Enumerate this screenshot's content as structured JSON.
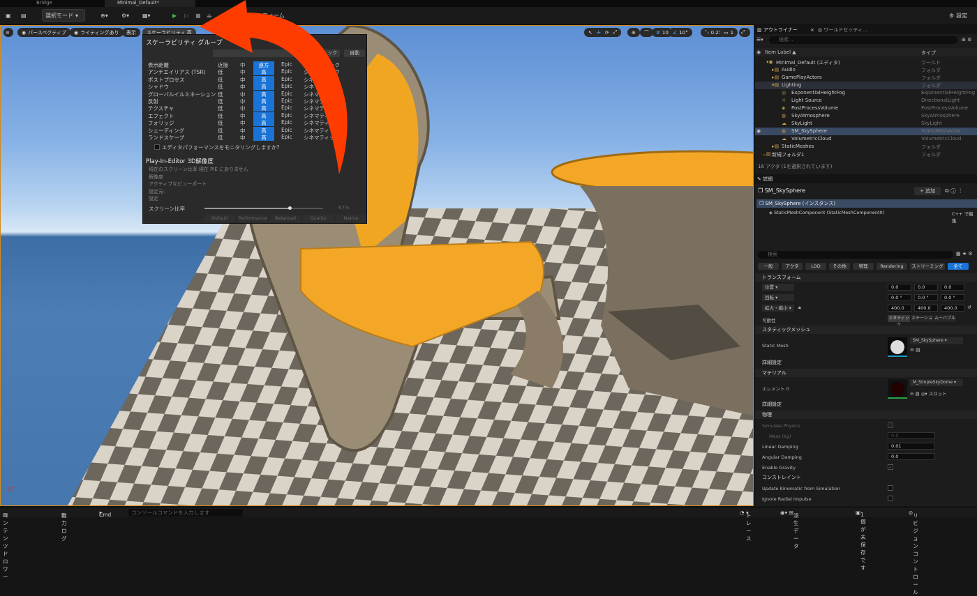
{
  "tabs": {
    "bridge": "Bridge",
    "level": "Minimal_Default*"
  },
  "toolbar": {
    "select_mode": "選択モード",
    "platform": "プラットフォーム",
    "settings": "設定"
  },
  "viewport": {
    "btn_perspective": "パースペクティブ",
    "btn_lighting": "ライティングあり",
    "btn_show": "表示",
    "btn_scalability": "スケーラビリティ 高",
    "grid_snap": "10",
    "rot_snap": "10°",
    "scale_snap": "0.25",
    "cam_speed": "1"
  },
  "scalability": {
    "title": "スケーラビリティ グループ",
    "auto": "自動",
    "cinematic_hdr": "シネマティック",
    "rows": [
      {
        "label": "表示距離",
        "c1": "近接",
        "c2": "中",
        "c3": "遠方",
        "c4": "Epic",
        "c5": "シネマティック"
      },
      {
        "label": "アンチエイリアス (TSR)",
        "c1": "低",
        "c2": "中",
        "c3": "高",
        "c4": "Epic",
        "c5": "シネマティック"
      },
      {
        "label": "ポストプロセス",
        "c1": "低",
        "c2": "中",
        "c3": "高",
        "c4": "Epic",
        "c5": "シネマティック"
      },
      {
        "label": "シャドウ",
        "c1": "低",
        "c2": "中",
        "c3": "高",
        "c4": "Epic",
        "c5": "シネマティック"
      },
      {
        "label": "グローバルイルミネーション",
        "c1": "低",
        "c2": "中",
        "c3": "高",
        "c4": "Epic",
        "c5": "シネマティック"
      },
      {
        "label": "反射",
        "c1": "低",
        "c2": "中",
        "c3": "高",
        "c4": "Epic",
        "c5": "シネマティック"
      },
      {
        "label": "テクスチャ",
        "c1": "低",
        "c2": "中",
        "c3": "高",
        "c4": "Epic",
        "c5": "シネマティック"
      },
      {
        "label": "エフェクト",
        "c1": "低",
        "c2": "中",
        "c3": "高",
        "c4": "Epic",
        "c5": "シネマティック"
      },
      {
        "label": "フォリッジ",
        "c1": "低",
        "c2": "中",
        "c3": "高",
        "c4": "Epic",
        "c5": "シネマティック"
      },
      {
        "label": "シェーディング",
        "c1": "低",
        "c2": "中",
        "c3": "高",
        "c4": "Epic",
        "c5": "シネマティック"
      },
      {
        "label": "ランドスケープ",
        "c1": "低",
        "c2": "中",
        "c3": "高",
        "c4": "Epic",
        "c5": "シネマティック"
      }
    ],
    "monitor": "エディタパフォーマンスをモニタリングしますか?",
    "pie_title": "Play-In-Editor 3D解像度",
    "pie_lines": [
      "現在のスクリーン比率 現在 PIE にありません",
      "解像度",
      "アクティブなビューポート",
      "設定元:",
      "設定"
    ],
    "screen_ratio": "スクリーン比率",
    "screen_pct": "67%",
    "screen_fill": 0.72,
    "presets": [
      "Default",
      "Performance",
      "Balanced",
      "Quality",
      "Native"
    ]
  },
  "outliner": {
    "tab": "アウトライナー",
    "tab2": "ワールドセッティ...",
    "search": "検索...",
    "col_label": "Item Label ▲",
    "col_type": "タイプ",
    "items": [
      {
        "label": "Minimal_Default (エディタ)",
        "type": "ワールド"
      },
      {
        "label": "Audio",
        "type": "フォルダ"
      },
      {
        "label": "GamePlayActors",
        "type": "フォルダ"
      },
      {
        "label": "Lighting",
        "type": "フォルダ"
      },
      {
        "label": "ExponentialHeightFog",
        "type": "ExponentialHeightFog"
      },
      {
        "label": "Light Source",
        "type": "DirectionalLight"
      },
      {
        "label": "PostProcessVolume",
        "type": "PostProcessVolume"
      },
      {
        "label": "SkyAtmosphere",
        "type": "SkyAtmosphere"
      },
      {
        "label": "SkyLight",
        "type": "SkyLight"
      },
      {
        "label": "SM_SkySphere",
        "type": "StaticMeshActor"
      },
      {
        "label": "VolumetricCloud",
        "type": "VolumetricCloud"
      },
      {
        "label": "StaticMeshes",
        "type": "フォルダ"
      },
      {
        "label": "新規フォルダ1",
        "type": "フォルダ"
      }
    ],
    "count": "16 アクタ (1を選択されています)"
  },
  "details": {
    "tab": "詳細",
    "name": "SM_SkySphere",
    "add": "+ 追加",
    "instance": "SM_SkySphere (インスタンス)",
    "component": "StaticMeshComponent (StaticMeshComponent0)",
    "cpp": "C++ で編集",
    "search": "検索",
    "filters": [
      "一般",
      "アクタ",
      "LOD",
      "その他",
      "物理",
      "Rendering",
      "ストリーミング",
      "全て"
    ],
    "transform": "トランスフォーム",
    "loc": "位置",
    "rot": "回転",
    "scale": "拡大・縮小",
    "loc_vals": [
      "0.0",
      "0.0",
      "0.0"
    ],
    "rot_vals": [
      "0.0 °",
      "0.0 °",
      "0.0 °"
    ],
    "scale_vals": [
      "400.0",
      "400.0",
      "400.0"
    ],
    "mobility": "可動性",
    "mob_opts": [
      "スタティック",
      "ステーショ",
      "ムーバブル"
    ],
    "static_mesh_sec": "スタティックメッシュ",
    "static_mesh": "Static Mesh",
    "mesh_val": "SM_SkySphere",
    "adv": "詳細設定",
    "material_sec": "マテリアル",
    "element0": "エレメント 0",
    "mat_val": "M_SimpleSkyDome",
    "slot": "スロット",
    "adv2": "詳細設定",
    "physics": "物理",
    "simulate": "Simulate Physics",
    "mass": "Mass (kg)",
    "mass_val": "0.0",
    "lin_damp": "Linear Damping",
    "lin_val": "0.01",
    "ang_damp": "Angular Damping",
    "ang_val": "0.0",
    "gravity": "Enable Gravity",
    "constraint": "コンストレイント",
    "update_kin": "Update Kinematic from Simulation",
    "ignore_radial": "Ignore Radial Impulse"
  },
  "status": {
    "content": "コンテンツドロワー",
    "output": "出力ログ",
    "cmd": "Cmd",
    "console": "コンソールコマンドを入力します",
    "trace": "トレース",
    "derived": "派生データ",
    "unsaved": "1個が未保存です",
    "revision": "リビジョンコントロール"
  },
  "colors": {
    "accent": "#1a73d6",
    "arrow": "#ff3c00",
    "selection": "#3a4a63"
  }
}
